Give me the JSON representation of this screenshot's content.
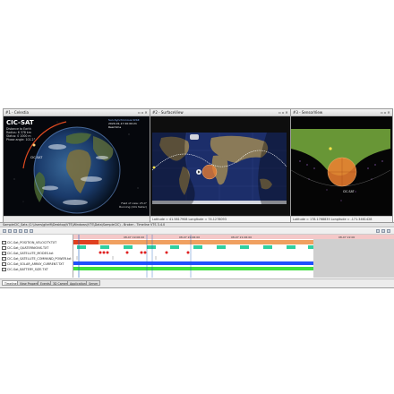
{
  "left_pane": {
    "title": "#1 - Celestia",
    "satellite_name": "CIC-SAT",
    "info_lines": [
      "Distance to Earth",
      "Radius: 6 378 km",
      "Status: 0 1000 m",
      "Phase angle: 101.2°"
    ],
    "top_right_lines": [
      "Sun-Synchronous Orbit",
      "2020-01-17 00:00:21",
      "Real time"
    ],
    "orbit_label": "CIC-SAT",
    "bottom_right_lines": [
      "Field of view: 25.0°",
      "Running (10x faster)"
    ]
  },
  "middle_pane": {
    "title": "#2 - SurfaceView",
    "status": "Latitude = 41.5817908 Longitude = 74.1278093"
  },
  "right_pane": {
    "title": "#3 - SensorView",
    "status": "Latitude = 178.1768835 Longitude = -171.3461428",
    "sat_label": "CIC-SAT"
  },
  "timeline": {
    "title": "SampleCIC_Sats (C:\\Users\\gitelfi\\Desktop\\VTS\\Windows\\VTS\\Data\\SampleCIC) - Broker - Timeline VTS 3.4.0",
    "date_labels": [
      "08-07 19:06:00",
      "08-07 20:06:00",
      "08-07 21:06:00",
      "08-07 22:00"
    ],
    "rows": [
      "CIC-Sat_POSITION_VELOCITY.TXT",
      "CIC-Sat_QUATERNIONS.TXT",
      "CIC-Sat_SATELLITE_MODES.txt",
      "CIC-Sat_SATELLITE_COMMAND_POWER.txt",
      "CIC-Sat_SOLAR_ARRAY_CURRENT.TXT",
      "CIC-Sat_BATTERY_SIZE.TXT"
    ],
    "tabs": [
      "Timeline",
      "View Properties",
      "Events",
      "3D Cameras",
      "Applications",
      "Server"
    ],
    "active_tab": "Timeline"
  },
  "colors": {
    "space_bg": "#05070c",
    "map_ocean": "#1c2e6a",
    "sun_orange": "#f08030",
    "green_region": "#7ab040",
    "timeline_orange": "#f0a060",
    "timeline_teal": "#30d0a0",
    "timeline_red": "#e02020",
    "timeline_blue": "#2050ff",
    "timeline_green": "#40e040"
  }
}
